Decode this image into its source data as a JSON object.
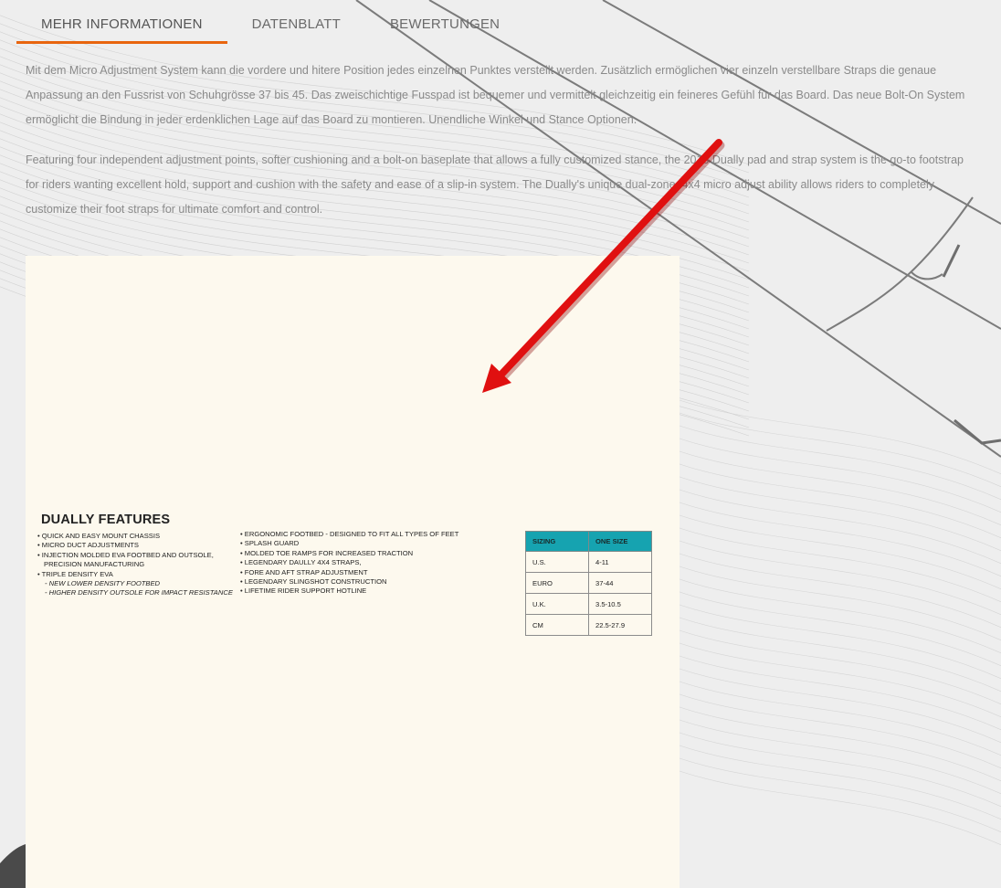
{
  "tabs": [
    {
      "label": "MEHR INFORMATIONEN",
      "active": true
    },
    {
      "label": "DATENBLATT",
      "active": false
    },
    {
      "label": "BEWERTUNGEN",
      "active": false
    }
  ],
  "description": {
    "german": "Mit dem Micro Adjustment System kann die vordere und hitere Position jedes einzelnen Punktes verstellt werden. Zusätzlich ermöglichen vier einzeln verstellbare Straps die genaue Anpassung an den Fussrist von Schuhgrösse 37 bis 45. Das zweischichtige Fusspad ist bequemer und vermittelt gleichzeitig ein feineres Gefühl für das Board. Das neue Bolt-On System ermöglicht die Bindung in jeder erdenklichen Lage auf das Board zu montieren. Unendliche Winkel und Stance Optionen.",
    "english": "Featuring four independent adjustment points, softer cushioning and a bolt-on baseplate that allows a fully customized stance, the 2016 Dually pad and strap system is the go-to footstrap for riders wanting excellent hold, support and cushion with the safety and ease of a slip-in system. The Dually's unique dual-zone, 4x4 micro adjust ability allows riders to completely customize their foot straps for ultimate comfort and control."
  },
  "features": {
    "title": "DUALLY FEATURES",
    "column1": [
      {
        "text": "• QUICK AND EASY MOUNT CHASSIS",
        "style": "item"
      },
      {
        "text": "• MICRO DUCT ADJUSTMENTS",
        "style": "item"
      },
      {
        "text": "• INJECTION MOLDED EVA FOOTBED AND OUTSOLE,",
        "style": "item"
      },
      {
        "text": "PRECISION MANUFACTURING",
        "style": "cont"
      },
      {
        "text": "• TRIPLE DENSITY EVA",
        "style": "item"
      },
      {
        "text": "- NEW LOWER DENSITY FOOTBED",
        "style": "sub"
      },
      {
        "text": "- HIGHER DENSITY OUTSOLE FOR IMPACT RESISTANCE",
        "style": "sub"
      }
    ],
    "column2": [
      {
        "text": "• ERGONOMIC FOOTBED - DESIGNED TO FIT ALL TYPES OF FEET",
        "style": "item"
      },
      {
        "text": "• SPLASH GUARD",
        "style": "item"
      },
      {
        "text": "• MOLDED TOE RAMPS FOR INCREASED TRACTION",
        "style": "item"
      },
      {
        "text": "• LEGENDARY DAULLY 4X4 STRAPS,",
        "style": "item"
      },
      {
        "text": "• FORE AND AFT STRAP ADJUSTMENT",
        "style": "item"
      },
      {
        "text": "• LEGENDARY SLINGSHOT CONSTRUCTION",
        "style": "item"
      },
      {
        "text": "• LIFETIME RIDER SUPPORT HOTLINE",
        "style": "item"
      }
    ]
  },
  "sizing_table": {
    "headers": [
      "SIZING",
      "ONE SIZE"
    ],
    "rows": [
      [
        "U.S.",
        "4-11"
      ],
      [
        "EURO",
        "37-44"
      ],
      [
        "U.K.",
        "3.5-10.5"
      ],
      [
        "CM",
        "22.5-27.9"
      ]
    ]
  },
  "colors": {
    "accent": "#e8650e",
    "table_header": "#16a3b0",
    "sheet_background": "#fdf9ee",
    "arrow": "#e01010"
  }
}
